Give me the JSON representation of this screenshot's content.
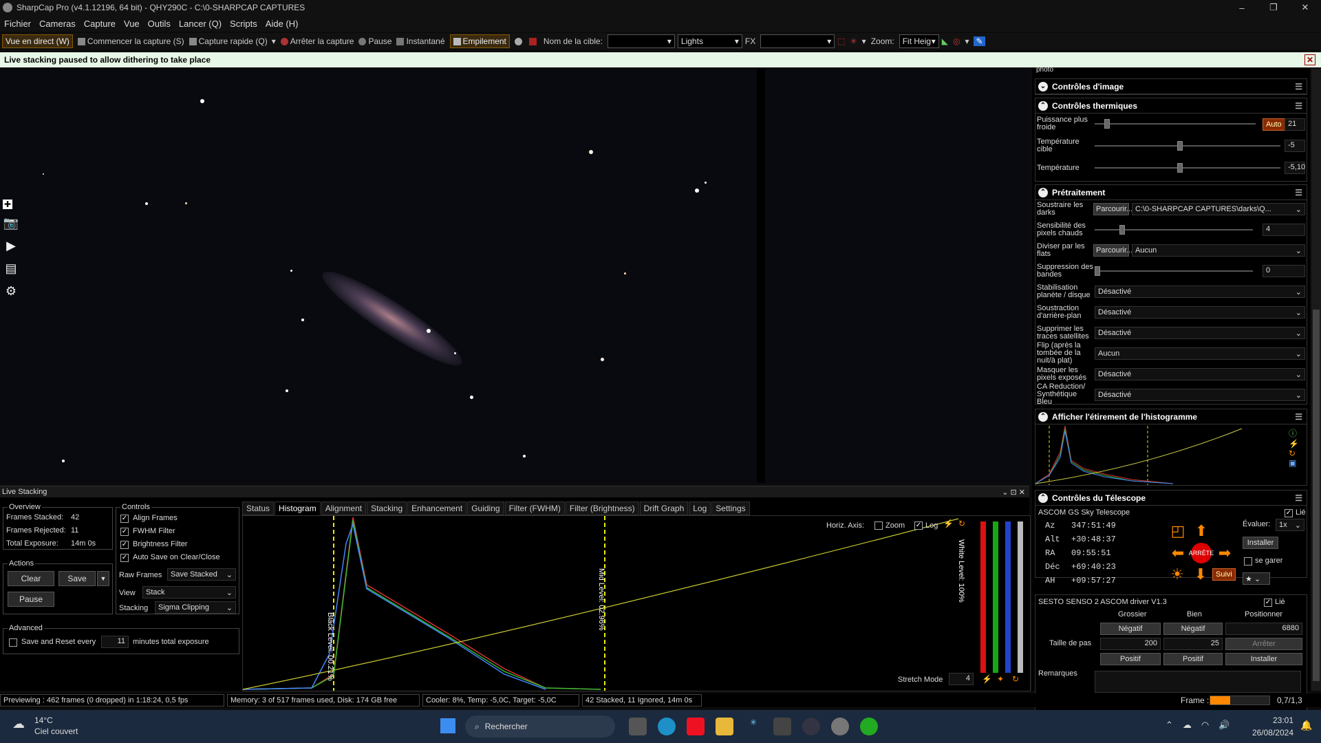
{
  "window": {
    "title": "SharpCap Pro (v4.1.12196, 64 bit) - QHY290C - C:\\0-SHARPCAP CAPTURES"
  },
  "menu": [
    "Fichier",
    "Cameras",
    "Capture",
    "Vue",
    "Outils",
    "Lancer (Q)",
    "Scripts",
    "Aide (H)"
  ],
  "toolbar": {
    "live_view": "Vue en direct (W)",
    "start_capture": "Commencer la capture (S)",
    "quick_capture": "Capture rapide (Q)",
    "stop_capture": "Arrêter la capture",
    "pause": "Pause",
    "snapshot": "Instantané",
    "stacking": "Empilement",
    "target_label": "Nom de la cible:",
    "frame_type": "Lights",
    "fx_label": "FX",
    "zoom_label": "Zoom:",
    "zoom_value": "Fit Heig"
  },
  "notice": {
    "text": "Live stacking paused to allow dithering to take place"
  },
  "right_panel": {
    "photo_cut": "photo",
    "image_controls": "Contrôles d'image",
    "thermal": {
      "title": "Contrôles thermiques",
      "cooler_power_label": "Puissance plus froide",
      "cooler_auto": "Auto",
      "cooler_value": "21",
      "target_temp_label": "Température cible",
      "target_temp_value": "-5",
      "temp_label": "Température",
      "temp_value": "-5,10"
    },
    "preprocessing": {
      "title": "Prétraitement",
      "darks_label": "Soustraire les darks",
      "browse": "Parcourir...",
      "darks_path": "C:\\0-SHARPCAP CAPTURES\\darks\\Q...",
      "hot_pixels_label": "Sensibilité des pixels chauds",
      "hot_pixels_value": "4",
      "flats_label": "Diviser par les flats",
      "flats_value": "Aucun",
      "banding_label": "Suppression des bandes",
      "banding_value": "0",
      "stabilization_label": "Stabilisation planète / disque",
      "stabilization_value": "Désactivé",
      "bg_label": "Soustraction d'arrière-plan",
      "bg_value": "Désactivé",
      "satellites_label": "Supprimer les traces satellites",
      "satellites_value": "Désactivé",
      "flip_label": "Flip (après la tombée de la nuit/à plat)",
      "flip_value": "Aucun",
      "mask_label": "Masquer les pixels exposés",
      "mask_value": "Désactivé",
      "ca_label": "CA Reduction/ Synthétique Bleu",
      "ca_value": "Désactivé"
    },
    "histogram": {
      "title": "Afficher l'étirement de l'histogramme"
    },
    "telescope": {
      "title": "Contrôles du Télescope",
      "driver": "ASCOM GS Sky Telescope",
      "linked": "Lié",
      "coords": [
        {
          "k": "Az",
          "v": "347:51:49"
        },
        {
          "k": "Alt",
          "v": "+30:48:37"
        },
        {
          "k": "RA",
          "v": "09:55:51"
        },
        {
          "k": "Déc",
          "v": "+69:40:23"
        },
        {
          "k": "AH",
          "v": "+09:57:27"
        }
      ],
      "rate_label": "Évaluer:",
      "rate_value": "1x",
      "install": "Installer",
      "park": "se garer",
      "stop": "ARRÊTE",
      "track": "Suivi"
    },
    "focuser": {
      "driver": "SESTO SENSO 2 ASCOM driver V1.3",
      "linked": "Lié",
      "coarse": "Grossier",
      "fine": "Bien",
      "position": "Positionner",
      "negative": "Négatif",
      "position_value": "6880",
      "step_label": "Taille de pas",
      "coarse_step": "200",
      "fine_step": "25",
      "stop": "Arrêter",
      "positive": "Positif",
      "install": "Installer"
    },
    "remarks": "Remarques"
  },
  "live_stacking": {
    "title": "Live Stacking",
    "overview": {
      "title": "Overview",
      "frames_stacked_label": "Frames Stacked:",
      "frames_stacked": "42",
      "frames_rejected_label": "Frames Rejected:",
      "frames_rejected": "11",
      "exposure_label": "Total Exposure:",
      "exposure": "14m 0s"
    },
    "actions": {
      "title": "Actions",
      "clear": "Clear",
      "save": "Save",
      "pause": "Pause"
    },
    "controls": {
      "title": "Controls",
      "align": "Align Frames",
      "fwhm": "FWHM Filter",
      "brightness": "Brightness Filter",
      "autosave": "Auto Save on Clear/Close",
      "raw_label": "Raw Frames",
      "raw_value": "Save Stacked",
      "view_label": "View",
      "view_value": "Stack",
      "stacking_label": "Stacking",
      "stacking_value": "Sigma Clipping"
    },
    "advanced": {
      "title": "Advanced",
      "reset_prefix": "Save and Reset every",
      "reset_value": "11",
      "reset_suffix": "minutes total exposure"
    },
    "tabs": [
      "Status",
      "Histogram",
      "Alignment",
      "Stacking",
      "Enhancement",
      "Guiding",
      "Filter (FWHM)",
      "Filter (Brightness)",
      "Drift Graph",
      "Log",
      "Settings"
    ],
    "active_tab": "Histogram",
    "histogram": {
      "horiz_axis": "Horiz. Axis:",
      "zoom": "Zoom",
      "log": "Log",
      "black_level": "Black Level: 00.21%",
      "mid_level": "Mid Level: 02.96%",
      "white_level": "White Level: 100%",
      "stretch_mode": "Stretch Mode",
      "stretch_value": "4"
    }
  },
  "status": {
    "preview": "Previewing : 462 frames (0 dropped) in 1:18:24, 0,5 fps",
    "memory": "Memory: 3 of 517 frames used, Disk: 174 GB free",
    "cooler": "Cooler: 8%, Temp: -5,0C, Target: -5,0C",
    "stacked": "42 Stacked, 11 Ignored, 14m 0s",
    "frame_label": "Frame :",
    "frame_value": "0,7/1,3"
  },
  "taskbar": {
    "weather_temp": "14°C",
    "weather_desc": "Ciel couvert",
    "search": "Rechercher",
    "time": "23:01",
    "date": "26/08/2024"
  },
  "colors": {
    "accent": "#ff8800",
    "notice_bg": "#e7f7e7",
    "orange_btn": "#8a2a00"
  }
}
